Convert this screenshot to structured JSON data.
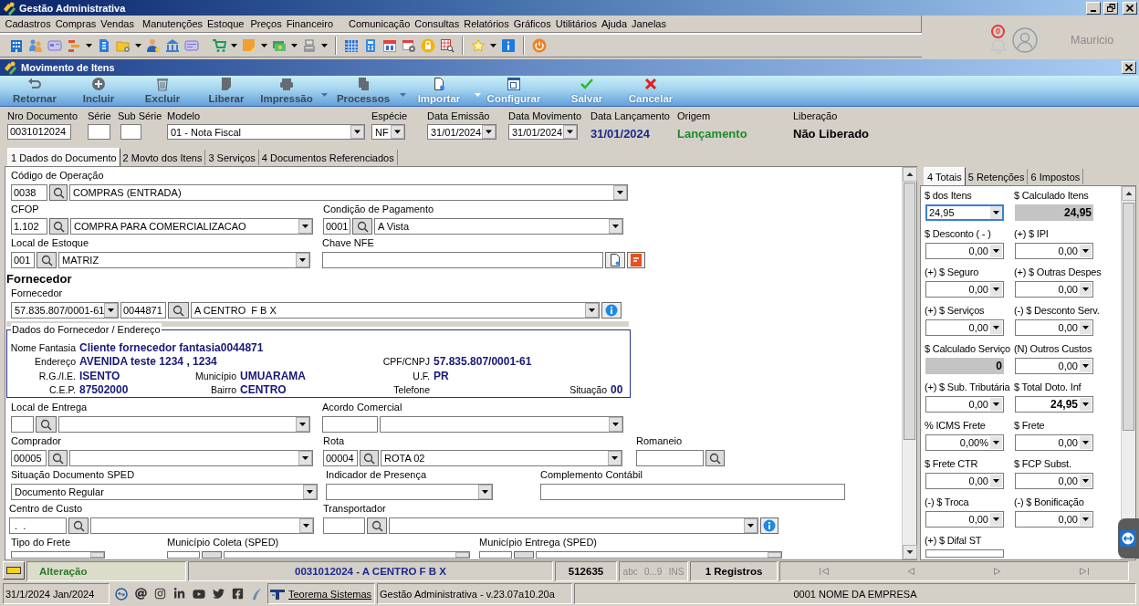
{
  "window": {
    "title": "Gestão Administrativa"
  },
  "menu": [
    "Cadastros",
    "Compras",
    "Vendas",
    "Manutenções",
    "Estoque",
    "Preços",
    "Financeiro",
    "Comunicação",
    "Consultas",
    "Relatórios",
    "Gráficos",
    "Utilitários",
    "Ajuda",
    "Janelas"
  ],
  "user": {
    "notifications": "0",
    "name": "Mauricio"
  },
  "document_window": {
    "title": "Movimento de Itens",
    "ribbon": [
      {
        "label": "Retornar",
        "disabled": true,
        "has_menu": false
      },
      {
        "label": "Incluir",
        "disabled": true,
        "has_menu": false
      },
      {
        "label": "Excluir",
        "disabled": true,
        "has_menu": false
      },
      {
        "label": "Liberar",
        "disabled": true,
        "has_menu": false
      },
      {
        "label": "Impressão",
        "disabled": true,
        "has_menu": true
      },
      {
        "label": "Processos",
        "disabled": true,
        "has_menu": true
      },
      {
        "label": "Importar",
        "disabled": false,
        "has_menu": true
      },
      {
        "label": "Configurar",
        "disabled": false,
        "has_menu": false
      },
      {
        "label": "Salvar",
        "disabled": false,
        "has_menu": false
      },
      {
        "label": "Cancelar",
        "disabled": false,
        "has_menu": false
      }
    ],
    "header": [
      {
        "label": "Nro Documento",
        "kind": "text",
        "value": "0031012024"
      },
      {
        "label": "Série",
        "kind": "text"
      },
      {
        "label": "Sub Série",
        "kind": "text"
      },
      {
        "label": "Modelo",
        "kind": "select",
        "value": "01 - Nota Fiscal"
      },
      {
        "label": "Espécie",
        "kind": "select",
        "value": "NF"
      },
      {
        "label": "Data Emissão",
        "kind": "select",
        "value": "31/01/2024"
      },
      {
        "label": "Data Movimento",
        "kind": "select",
        "value": "31/01/2024"
      },
      {
        "label": "Data Lançamento",
        "kind": "display",
        "value": "31/01/2024",
        "color": "#1c2a8c"
      },
      {
        "label": "Origem",
        "kind": "display",
        "value": "Lançamento",
        "color": "#1e8c2a"
      },
      {
        "label": "Liberação",
        "kind": "display",
        "value": "Não Liberado",
        "color": "#000000"
      }
    ],
    "tabs": [
      {
        "label": "1 Dados do Documento",
        "selected": true
      },
      {
        "label": "2 Movto dos Itens",
        "selected": false
      },
      {
        "label": "3 Serviços",
        "selected": false
      },
      {
        "label": "4 Documentos Referenciados",
        "selected": false
      }
    ],
    "form": [
      {
        "kind": "fields",
        "groups": [
          {
            "label": "Código de Operação",
            "controls": [
              {
                "kind": "text",
                "value": "0038"
              },
              {
                "kind": "lookup"
              },
              {
                "kind": "select",
                "value": "COMPRAS (ENTRADA)"
              }
            ]
          }
        ]
      },
      {
        "kind": "fields",
        "groups": [
          {
            "label": "CFOP",
            "controls": [
              {
                "kind": "text",
                "value": "1.102"
              },
              {
                "kind": "lookup"
              },
              {
                "kind": "select",
                "value": "COMPRA PARA COMERCIALIZACAO"
              }
            ]
          },
          {
            "label": "Condição de Pagamento",
            "controls": [
              {
                "kind": "text",
                "value": "0001"
              },
              {
                "kind": "lookup"
              },
              {
                "kind": "select",
                "value": "A Vista"
              }
            ]
          }
        ]
      },
      {
        "kind": "fields",
        "groups": [
          {
            "label": "Local de Estoque",
            "controls": [
              {
                "kind": "text",
                "value": "001"
              },
              {
                "kind": "lookup"
              },
              {
                "kind": "select",
                "value": "MATRIZ"
              }
            ]
          },
          {
            "label": "Chave NFE",
            "controls": [
              {
                "kind": "text"
              },
              {
                "kind": "document"
              },
              {
                "kind": "pdf"
              }
            ]
          }
        ]
      },
      {
        "kind": "heading",
        "text": "Fornecedor"
      },
      {
        "kind": "fields",
        "groups": [
          {
            "label": "Fornecedor",
            "controls": [
              {
                "kind": "select",
                "value": "57.835.807/0001-61"
              },
              {
                "kind": "text",
                "value": "0044871"
              },
              {
                "kind": "lookup"
              },
              {
                "kind": "select",
                "value": "A CENTRO  F B X"
              },
              {
                "kind": "info"
              }
            ]
          }
        ]
      },
      {
        "kind": "details",
        "title": "Dados do Fornecedor / Endereço",
        "rows": [
          [
            {
              "label": "Nome Fantasia",
              "value": "Cliente fornecedor fantasia0044871"
            }
          ],
          [
            {
              "label": "Endereço",
              "value": "AVENIDA teste 1234 , 1234"
            },
            "",
            {
              "label": "CPF/CNPJ",
              "value": "57.835.807/0001-61"
            }
          ],
          [
            {
              "label": "R.G./I.E.",
              "value": "ISENTO"
            },
            {
              "label": "Município",
              "value": "UMUARAMA"
            },
            {
              "label": "U.F.",
              "value": "PR"
            }
          ],
          [
            {
              "label": "C.E.P.",
              "value": "87502000"
            },
            {
              "label": "Bairro",
              "value": "CENTRO"
            },
            {
              "label": "Telefone"
            },
            {
              "label": "Situação",
              "value": "00"
            }
          ]
        ]
      },
      {
        "kind": "fields",
        "groups": [
          {
            "label": "Local de Entrega",
            "controls": [
              {
                "kind": "text"
              },
              {
                "kind": "lookup"
              },
              {
                "kind": "select"
              }
            ]
          },
          {
            "label": "Acordo Comercial",
            "controls": [
              {
                "kind": "text"
              },
              {
                "kind": "select"
              }
            ]
          }
        ]
      },
      {
        "kind": "fields",
        "groups": [
          {
            "label": "Comprador",
            "controls": [
              {
                "kind": "text",
                "value": "00005"
              },
              {
                "kind": "lookup"
              },
              {
                "kind": "select"
              }
            ]
          },
          {
            "label": "Rota",
            "controls": [
              {
                "kind": "text",
                "value": "00004"
              },
              {
                "kind": "lookup"
              },
              {
                "kind": "select",
                "value": "ROTA 02"
              }
            ]
          },
          {
            "label": "Romaneio",
            "controls": [
              {
                "kind": "text"
              },
              {
                "kind": "lookup"
              }
            ]
          }
        ]
      },
      {
        "kind": "fields",
        "groups": [
          {
            "label": "Situação Documento SPED",
            "controls": [
              {
                "kind": "select",
                "value": "Documento Regular"
              }
            ]
          },
          {
            "label": "Indicador de Presença",
            "controls": [
              {
                "kind": "select"
              }
            ]
          },
          {
            "label": "Complemento Contábil",
            "controls": [
              {
                "kind": "text"
              }
            ]
          }
        ]
      },
      {
        "kind": "fields",
        "groups": [
          {
            "label": "Centro de Custo",
            "controls": [
              {
                "kind": "text",
                "value": " .  ."
              },
              {
                "kind": "lookup"
              },
              {
                "kind": "select"
              }
            ]
          },
          {
            "label": "Transportador",
            "controls": [
              {
                "kind": "text"
              },
              {
                "kind": "lookup"
              },
              {
                "kind": "select"
              },
              {
                "kind": "info"
              }
            ]
          }
        ]
      },
      {
        "kind": "fields",
        "groups": [
          {
            "label": "Tipo do Frete",
            "controls": [
              {
                "kind": "select"
              }
            ]
          },
          {
            "label": "Município Coleta (SPED)",
            "controls": [
              {
                "kind": "text"
              },
              {
                "kind": "lookup"
              },
              {
                "kind": "select"
              }
            ]
          },
          {
            "label": "Município Entrega (SPED)",
            "controls": [
              {
                "kind": "text"
              },
              {
                "kind": "lookup"
              },
              {
                "kind": "select"
              }
            ]
          }
        ]
      }
    ],
    "totals_tabs": [
      {
        "label": "4 Totais",
        "selected": true
      },
      {
        "label": "5 Retenções",
        "selected": false
      },
      {
        "label": "6 Impostos",
        "selected": false
      }
    ],
    "totals": [
      {
        "label": "$ dos Itens",
        "field": {
          "kind": "entry",
          "value": "24,95",
          "focused": true
        }
      },
      {
        "label": "$ Calculado Itens",
        "field": {
          "kind": "computed",
          "value": "24,95",
          "focused": false
        }
      },
      {
        "label": "$ Desconto ( - )",
        "field": {
          "kind": "amount",
          "value": "0,00",
          "focused": false
        }
      },
      {
        "label": "(+) $ IPI",
        "field": {
          "kind": "amount",
          "value": "0,00",
          "focused": false
        }
      },
      {
        "label": "(+) $ Seguro",
        "field": {
          "kind": "amount",
          "value": "0,00",
          "focused": false
        }
      },
      {
        "label": "(+) $ Outras Despes",
        "field": {
          "kind": "amount",
          "value": "0,00",
          "focused": false
        }
      },
      {
        "label": "(+) $ Serviços",
        "field": {
          "kind": "amount",
          "value": "0,00",
          "focused": false
        }
      },
      {
        "label": "(-) $ Desconto Serv.",
        "field": {
          "kind": "amount",
          "value": "0,00",
          "focused": false
        }
      },
      {
        "label": "$ Calculado Serviço",
        "field": {
          "kind": "computed",
          "value": "0",
          "focused": false
        }
      },
      {
        "label": "(N) Outros Custos",
        "field": {
          "kind": "amount",
          "value": "0,00",
          "focused": false
        }
      },
      {
        "label": "(+) $ Sub. Tributária",
        "field": {
          "kind": "amount",
          "value": "0,00",
          "focused": false
        }
      },
      {
        "label": "$ Total Doto. Inf",
        "field": {
          "kind": "total",
          "value": "24,95",
          "focused": false
        }
      },
      {
        "label": "% ICMS Frete",
        "field": {
          "kind": "amount",
          "value": "0,00%",
          "focused": false
        }
      },
      {
        "label": "$ Frete",
        "field": {
          "kind": "amount",
          "value": "0,00",
          "focused": false
        }
      },
      {
        "label": "$ Frete CTR",
        "field": {
          "kind": "amount",
          "value": "0,00",
          "focused": false
        }
      },
      {
        "label": "$ FCP Subst.",
        "field": {
          "kind": "amount",
          "value": "0,00",
          "focused": false
        }
      },
      {
        "label": "(-) $ Troca",
        "field": {
          "kind": "amount",
          "value": "0,00",
          "focused": false
        }
      },
      {
        "label": "(-) $ Bonificação",
        "field": {
          "kind": "amount",
          "value": "0,00",
          "focused": false
        }
      },
      {
        "label": "(+) $ Difal ST",
        "field": {
          "kind": "amount",
          "focused": false
        }
      }
    ]
  },
  "status_bar": {
    "mode": "Alteração",
    "record": "0031012024 - A CENTRO  F B X",
    "code": "512635",
    "indicators": [
      {
        "label": "abc",
        "on": false
      },
      {
        "label": "0...9",
        "on": false
      },
      {
        "label": "INS",
        "on": false
      }
    ],
    "count": "1 Registros"
  },
  "footer": {
    "date": "31/1/2024 Jan/2024",
    "link": "Teorema Sistemas",
    "version": "Gestão Administrativa - v.23.07a10.20a",
    "company": "0001 NOME DA EMPRESA"
  }
}
